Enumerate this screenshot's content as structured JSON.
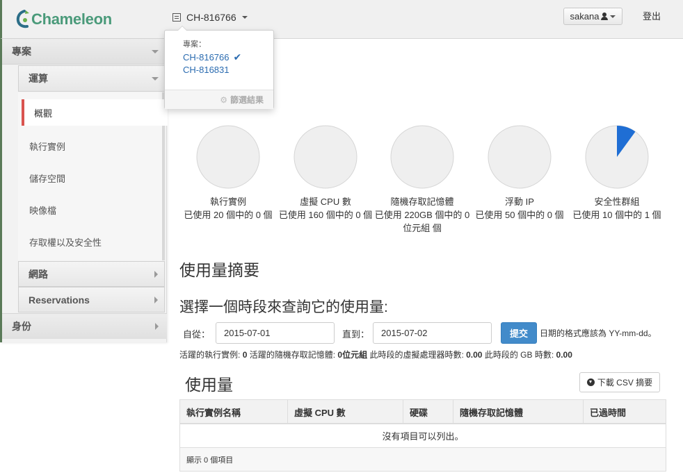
{
  "header": {
    "brand": "Chameleon",
    "current_project": "CH-816766",
    "user": "sakana",
    "logout": "登出"
  },
  "project_dropdown": {
    "header": "專案：",
    "projects": [
      "CH-816766",
      "CH-816831"
    ],
    "filter_label": "篩選結果"
  },
  "sidebar": {
    "project": "專案",
    "compute": "運算",
    "items": [
      "概觀",
      "執行實例",
      "儲存空間",
      "映像檔",
      "存取權以及安全性"
    ],
    "network": "網路",
    "reservations": "Reservations",
    "identity": "身份"
  },
  "quotas": [
    {
      "name": "執行實例",
      "usage": "已使用 20 個中的 0 個",
      "used": 0,
      "total": 20
    },
    {
      "name": "虛擬 CPU 數",
      "usage": "已使用 160 個中的 0 個",
      "used": 0,
      "total": 160
    },
    {
      "name": "隨機存取記憶體",
      "usage": "已使用 220GB 個中的 0 位元組 個",
      "used": 0,
      "total": 220
    },
    {
      "name": "浮動 IP",
      "usage": "已使用 50 個中的 0 個",
      "used": 0,
      "total": 50
    },
    {
      "name": "安全性群組",
      "usage": "已使用 10 個中的 1 個",
      "used": 1,
      "total": 10
    }
  ],
  "colors": {
    "pie_bg": "#efefef",
    "pie_fill": "#1f6ed4",
    "accent": "#428bca",
    "active_border": "#d9534f"
  },
  "usage_summary": {
    "title": "使用量摘要",
    "subtitle": "選擇一個時段來查詢它的使用量:",
    "from_label": "自從：",
    "from_value": "2015-07-01",
    "to_label": "直到：",
    "to_value": "2015-07-02",
    "submit": "提交",
    "hint": "日期的格式應該為 YY-mm-dd。",
    "stats": [
      {
        "label": "活躍的執行實例:",
        "value": "0"
      },
      {
        "label": "活躍的隨機存取記憶體:",
        "value": "0位元組"
      },
      {
        "label": "此時段的虛擬處理器時數:",
        "value": "0.00"
      },
      {
        "label": "此時段的 GB 時數:",
        "value": "0.00"
      }
    ]
  },
  "usage_table": {
    "title": "使用量",
    "csv_button": "下載 CSV 摘要",
    "columns": [
      "執行實例名稱",
      "虛擬 CPU 數",
      "硬碟",
      "隨機存取記憶體",
      "已過時間"
    ],
    "empty": "沒有項目可以列出。",
    "footer": "顯示 0 個項目"
  }
}
